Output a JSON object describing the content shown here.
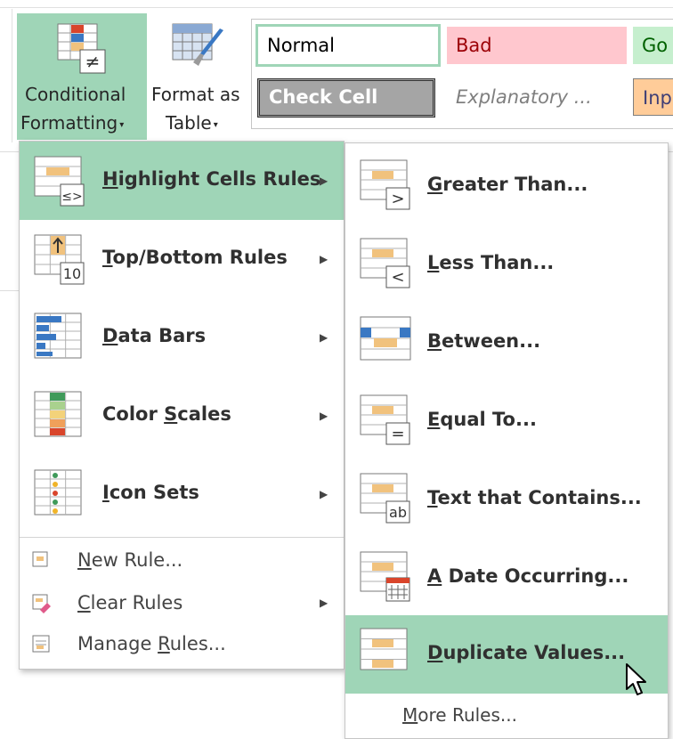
{
  "ribbon": {
    "conditional_formatting": {
      "line1": "Conditional",
      "line2": "Formatting",
      "caret": "▾",
      "icon": "conditional-formatting-icon"
    },
    "format_as_table": {
      "line1": "Format as",
      "line2": "Table",
      "caret": "▾",
      "icon": "format-as-table-icon"
    },
    "styles": [
      {
        "label": "Normal",
        "bg": "#ffffff",
        "color": "#000000"
      },
      {
        "label": "Bad",
        "bg": "#ffc7ce",
        "color": "#9c0006"
      },
      {
        "label": "Go",
        "bg": "#c6efce",
        "color": "#006100"
      },
      {
        "label": "Check Cell",
        "bg": "#a5a5a5",
        "color": "#ffffff"
      },
      {
        "label": "Explanatory ...",
        "bg": "#ffffff",
        "color": "#7f7f7f"
      },
      {
        "label": "Inp",
        "bg": "#ffcc99",
        "color": "#3f3f76"
      }
    ]
  },
  "menu": {
    "items": [
      {
        "pre": "",
        "u": "H",
        "post": "ighlight Cells Rules",
        "icon": "highlight-cells-rules-icon",
        "has_submenu": true,
        "highlighted": true
      },
      {
        "pre": "",
        "u": "T",
        "post": "op/Bottom Rules",
        "icon": "top-bottom-rules-icon",
        "has_submenu": true
      },
      {
        "pre": "",
        "u": "D",
        "post": "ata Bars",
        "icon": "data-bars-icon",
        "has_submenu": true
      },
      {
        "pre": "Color ",
        "u": "S",
        "post": "cales",
        "icon": "color-scales-icon",
        "has_submenu": true
      },
      {
        "pre": "",
        "u": "I",
        "post": "con Sets",
        "icon": "icon-sets-icon",
        "has_submenu": true
      }
    ],
    "small_items": [
      {
        "pre": "",
        "u": "N",
        "post": "ew Rule...",
        "icon": "new-rule-icon",
        "has_submenu": false
      },
      {
        "pre": "",
        "u": "C",
        "post": "lear Rules",
        "icon": "clear-rules-icon",
        "has_submenu": true
      },
      {
        "pre": "Manage ",
        "u": "R",
        "post": "ules...",
        "icon": "manage-rules-icon",
        "has_submenu": false
      }
    ],
    "submenu_arrow": "▶"
  },
  "submenu": {
    "items": [
      {
        "pre": "",
        "u": "G",
        "post": "reater Than...",
        "icon": "greater-than-icon",
        "glyph": ">"
      },
      {
        "pre": "",
        "u": "L",
        "post": "ess Than...",
        "icon": "less-than-icon",
        "glyph": "<"
      },
      {
        "pre": "",
        "u": "B",
        "post": "etween...",
        "icon": "between-icon",
        "glyph": ""
      },
      {
        "pre": "",
        "u": "E",
        "post": "qual To...",
        "icon": "equal-to-icon",
        "glyph": "="
      },
      {
        "pre": "",
        "u": "T",
        "post": "ext that Contains...",
        "icon": "text-contains-icon",
        "glyph": "ab"
      },
      {
        "pre": "",
        "u": "A",
        "post": " Date Occurring...",
        "icon": "date-occurring-icon",
        "glyph": ""
      },
      {
        "pre": "",
        "u": "D",
        "post": "uplicate Values...",
        "icon": "duplicate-values-icon",
        "glyph": "",
        "highlighted": true
      }
    ],
    "more": {
      "pre": "",
      "u": "M",
      "post": "ore Rules..."
    }
  },
  "top_bottom_glyph": "10",
  "highlight_glyph": "≤>",
  "cf_glyph": "≠",
  "colors": {
    "highlight": "#9fd5b7",
    "accent_cell": "#f1c27d",
    "blue": "#3a78c3"
  }
}
